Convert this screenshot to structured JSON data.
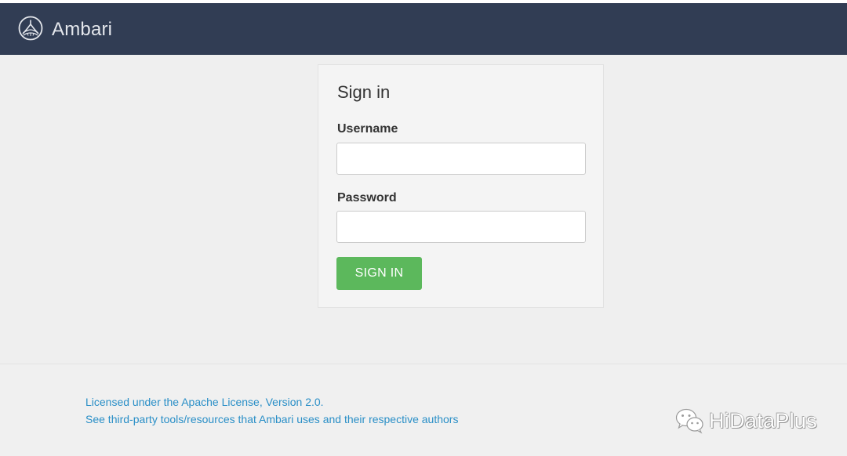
{
  "header": {
    "app_name": "Ambari",
    "logo_icon": "ambari-logo-icon"
  },
  "login": {
    "title": "Sign in",
    "username_label": "Username",
    "username_value": "",
    "username_placeholder": "",
    "password_label": "Password",
    "password_value": "",
    "password_placeholder": "",
    "submit_label": "SIGN IN"
  },
  "footer": {
    "license_text": "Licensed under the Apache License, Version 2.0.",
    "third_party_text": "See third-party tools/resources that Ambari uses and their respective authors"
  },
  "watermark": {
    "text": "HiDataPlus",
    "icon": "wechat-icon"
  },
  "colors": {
    "navbar": "#313d54",
    "background": "#efefef",
    "primary_button": "#5cb85c",
    "link": "#2a8fc7"
  }
}
